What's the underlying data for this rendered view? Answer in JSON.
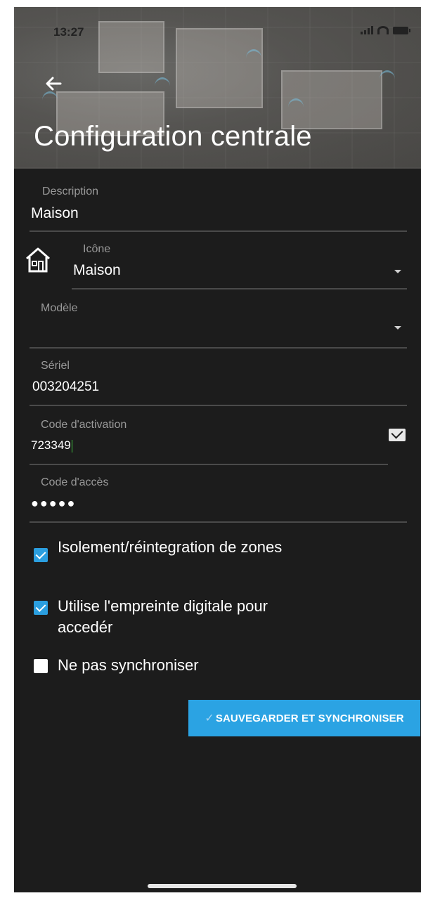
{
  "status_bar": {
    "time": "13:27"
  },
  "header": {
    "title": "Configuration centrale"
  },
  "fields": {
    "description": {
      "label": "Description",
      "value": "Maison"
    },
    "icon": {
      "label": "Icône",
      "value": "Maison"
    },
    "model": {
      "label": "Modèle",
      "value": ""
    },
    "serial": {
      "label": "Sériel",
      "value": "003204251"
    },
    "activation": {
      "label": "Code d'activation",
      "value": "723349"
    },
    "access": {
      "label": "Code d'accès",
      "value": "●●●●●"
    }
  },
  "options": [
    {
      "label": "Isolement/réintegration de zones",
      "checked": true
    },
    {
      "label": "Utilise l'empreinte digitale pour accedér",
      "checked": true
    },
    {
      "label": "Ne pas synchroniser",
      "checked": false
    }
  ],
  "actions": {
    "save_label": "SAUVEGARDER ET SYNCHRONISER",
    "save_check": "✓"
  },
  "colors": {
    "accent": "#2ba3e3",
    "background": "#1c1c1c",
    "divider": "#4a4a4a"
  }
}
